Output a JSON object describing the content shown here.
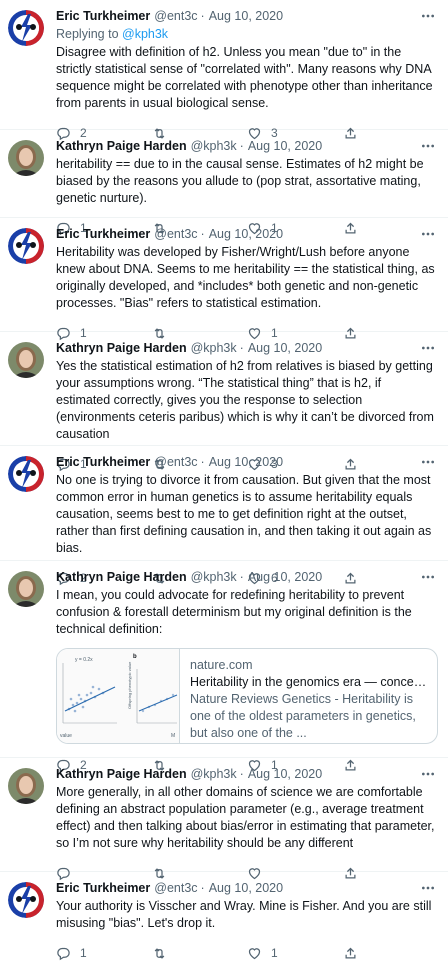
{
  "colors": {
    "accent": "#1d9bf0",
    "secondary": "#536471",
    "divider": "#eff3f4"
  },
  "tweets": [
    {
      "avatar": "grateful-dead-skull",
      "name": "Eric Turkheimer",
      "handle": "@ent3c",
      "dot": "·",
      "date": "Aug 10, 2020",
      "reply_prefix": "Replying to ",
      "reply_to": "@kph3k",
      "text": "Disagree with definition of h2. Unless you mean \"due to\" in the strictly statistical sense of \"correlated with\". Many reasons why DNA sequence might be correlated with phenotype other than inheritance from parents in usual biological sense.",
      "replies": "2",
      "retweets": "",
      "likes": "3"
    },
    {
      "avatar": "portrait",
      "name": "Kathryn Paige Harden",
      "handle": "@kph3k",
      "dot": "·",
      "date": "Aug 10, 2020",
      "text": "heritability == due to in the causal sense. Estimates of h2 might be biased by the reasons you allude to (pop strat, assortative mating, genetic nurture).",
      "replies": "1",
      "retweets": "",
      "likes": "1"
    },
    {
      "avatar": "grateful-dead-skull",
      "name": "Eric Turkheimer",
      "handle": "@ent3c",
      "dot": "·",
      "date": "Aug 10, 2020",
      "text": "Heritability was developed by Fisher/Wright/Lush before anyone knew about DNA. Seems to me heritability == the statistical thing, as originally developed, and *includes* both genetic and non-genetic processes. \"Bias\" refers to statistical estimation.",
      "replies": "1",
      "retweets": "",
      "likes": "1"
    },
    {
      "avatar": "portrait",
      "name": "Kathryn Paige Harden",
      "handle": "@kph3k",
      "dot": "·",
      "date": "Aug 10, 2020",
      "text": "Yes the statistical estimation of h2 from relatives is biased by getting your assumptions wrong. “The statistical thing” that is h2, if estimated correctly, gives you the response to selection (environments ceteris paribus) which is why it can’t be divorced from causation",
      "replies": "1",
      "retweets": "",
      "likes": "3"
    },
    {
      "avatar": "grateful-dead-skull",
      "name": "Eric Turkheimer",
      "handle": "@ent3c",
      "dot": "·",
      "date": "Aug 10, 2020",
      "text": "No one is trying to divorce it from causation. But given that the most common error in human genetics is to assume heritability equals causation, seems best to me to get definition right at the outset, rather than first defining causation in, and then taking it out again as bias.",
      "replies": "2",
      "retweets": "",
      "likes": "6"
    },
    {
      "avatar": "portrait",
      "name": "Kathryn Paige Harden",
      "handle": "@kph3k",
      "dot": "·",
      "date": "Aug 10, 2020",
      "text": "I mean, you could advocate for redefining heritability to prevent confusion & forestall determinism but my original definition is the technical definition:",
      "card": {
        "domain": "nature.com",
        "title": "Heritability in the genomics era — concepts and mi...",
        "description": "Nature Reviews Genetics - Heritability is one of the oldest parameters in genetics, but also one of the ...",
        "thumb_labels": {
          "eq": "y = 0.2x",
          "panel": "b",
          "yaxis": "Offspring phenotypic value",
          "xaxis": "value",
          "corner": "M"
        }
      },
      "replies": "2",
      "retweets": "",
      "likes": "1"
    },
    {
      "avatar": "portrait",
      "name": "Kathryn Paige Harden",
      "handle": "@kph3k",
      "dot": "·",
      "date": "Aug 10, 2020",
      "text": "More generally, in all other domains of science we are comfortable defining an abstract population parameter (e.g., average treatment effect) and then talking about bias/error in estimating that parameter, so I’m not sure why heritability should be any different",
      "replies": "",
      "retweets": "",
      "likes": ""
    },
    {
      "avatar": "grateful-dead-skull",
      "name": "Eric Turkheimer",
      "handle": "@ent3c",
      "dot": "·",
      "date": "Aug 10, 2020",
      "text": "Your authority is Visscher and Wray. Mine is Fisher. And you are still misusing \"bias\". Let's drop it.",
      "replies": "1",
      "retweets": "",
      "likes": "1"
    }
  ]
}
